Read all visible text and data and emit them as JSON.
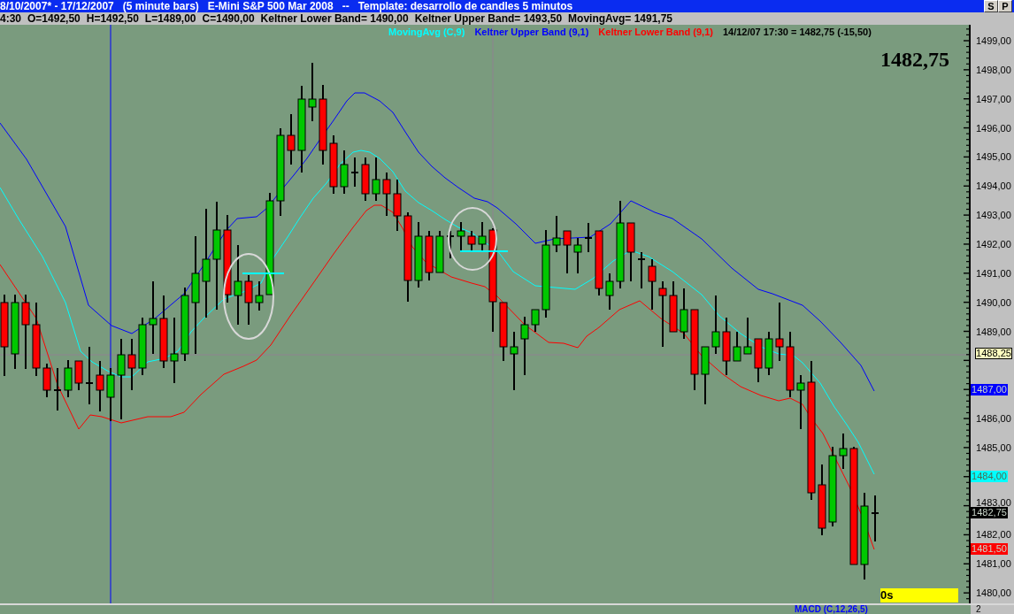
{
  "title_bar": {
    "parts": [
      "8/10/2007* - 17/12/2007",
      "(5 minute bars)",
      "E-Mini S&P 500 Mar 2008",
      "--",
      "Template: desarrollo de candles 5 minutos"
    ],
    "buttons": [
      "S",
      "P"
    ]
  },
  "info_bar": {
    "items": [
      "4:30",
      "O=1492,50",
      "H=1492,50",
      "L=1489,00",
      "C=1490,00",
      "Keltner Lower Band= 1490,00",
      "Keltner Upper Band= 1493,50",
      "MovingAvg= 1491,75"
    ]
  },
  "price_chart": {
    "legend": [
      {
        "label": "MovingAvg (C,9)",
        "color": "#00ffff"
      },
      {
        "label": "Keltner Upper Band (9,1)",
        "color": "#0000ff"
      },
      {
        "label": "Keltner Lower Band (9,1)",
        "color": "#ff0000"
      }
    ],
    "cursor_readout": "14/12/07 17:30 = 1482,75 (-15,50)",
    "last_price": "1482,75",
    "timer": "0s",
    "axis_labels": [
      "1499,00",
      "1498,00",
      "1497,00",
      "1496,00",
      "1495,00",
      "1494,00",
      "1493,00",
      "1492,00",
      "1491,00",
      "1490,00",
      "1489,00",
      "1486,00",
      "1485,00",
      "1483,00",
      "1482,00",
      "1481,00",
      "1480,00"
    ],
    "price_tags": [
      {
        "kind": "cursor",
        "label": "1488,25"
      },
      {
        "kind": "series",
        "label": "1487,00",
        "color": "#0000ff"
      },
      {
        "kind": "series",
        "label": "1484,00",
        "color": "#00ffff"
      },
      {
        "kind": "series",
        "label": "1482,75",
        "color": "#000000"
      },
      {
        "kind": "series",
        "label": "1481,50",
        "color": "#ff0000"
      }
    ]
  },
  "macd_pane": {
    "title": "MACD (C,12,26,5)",
    "axis_label": "2"
  }
}
